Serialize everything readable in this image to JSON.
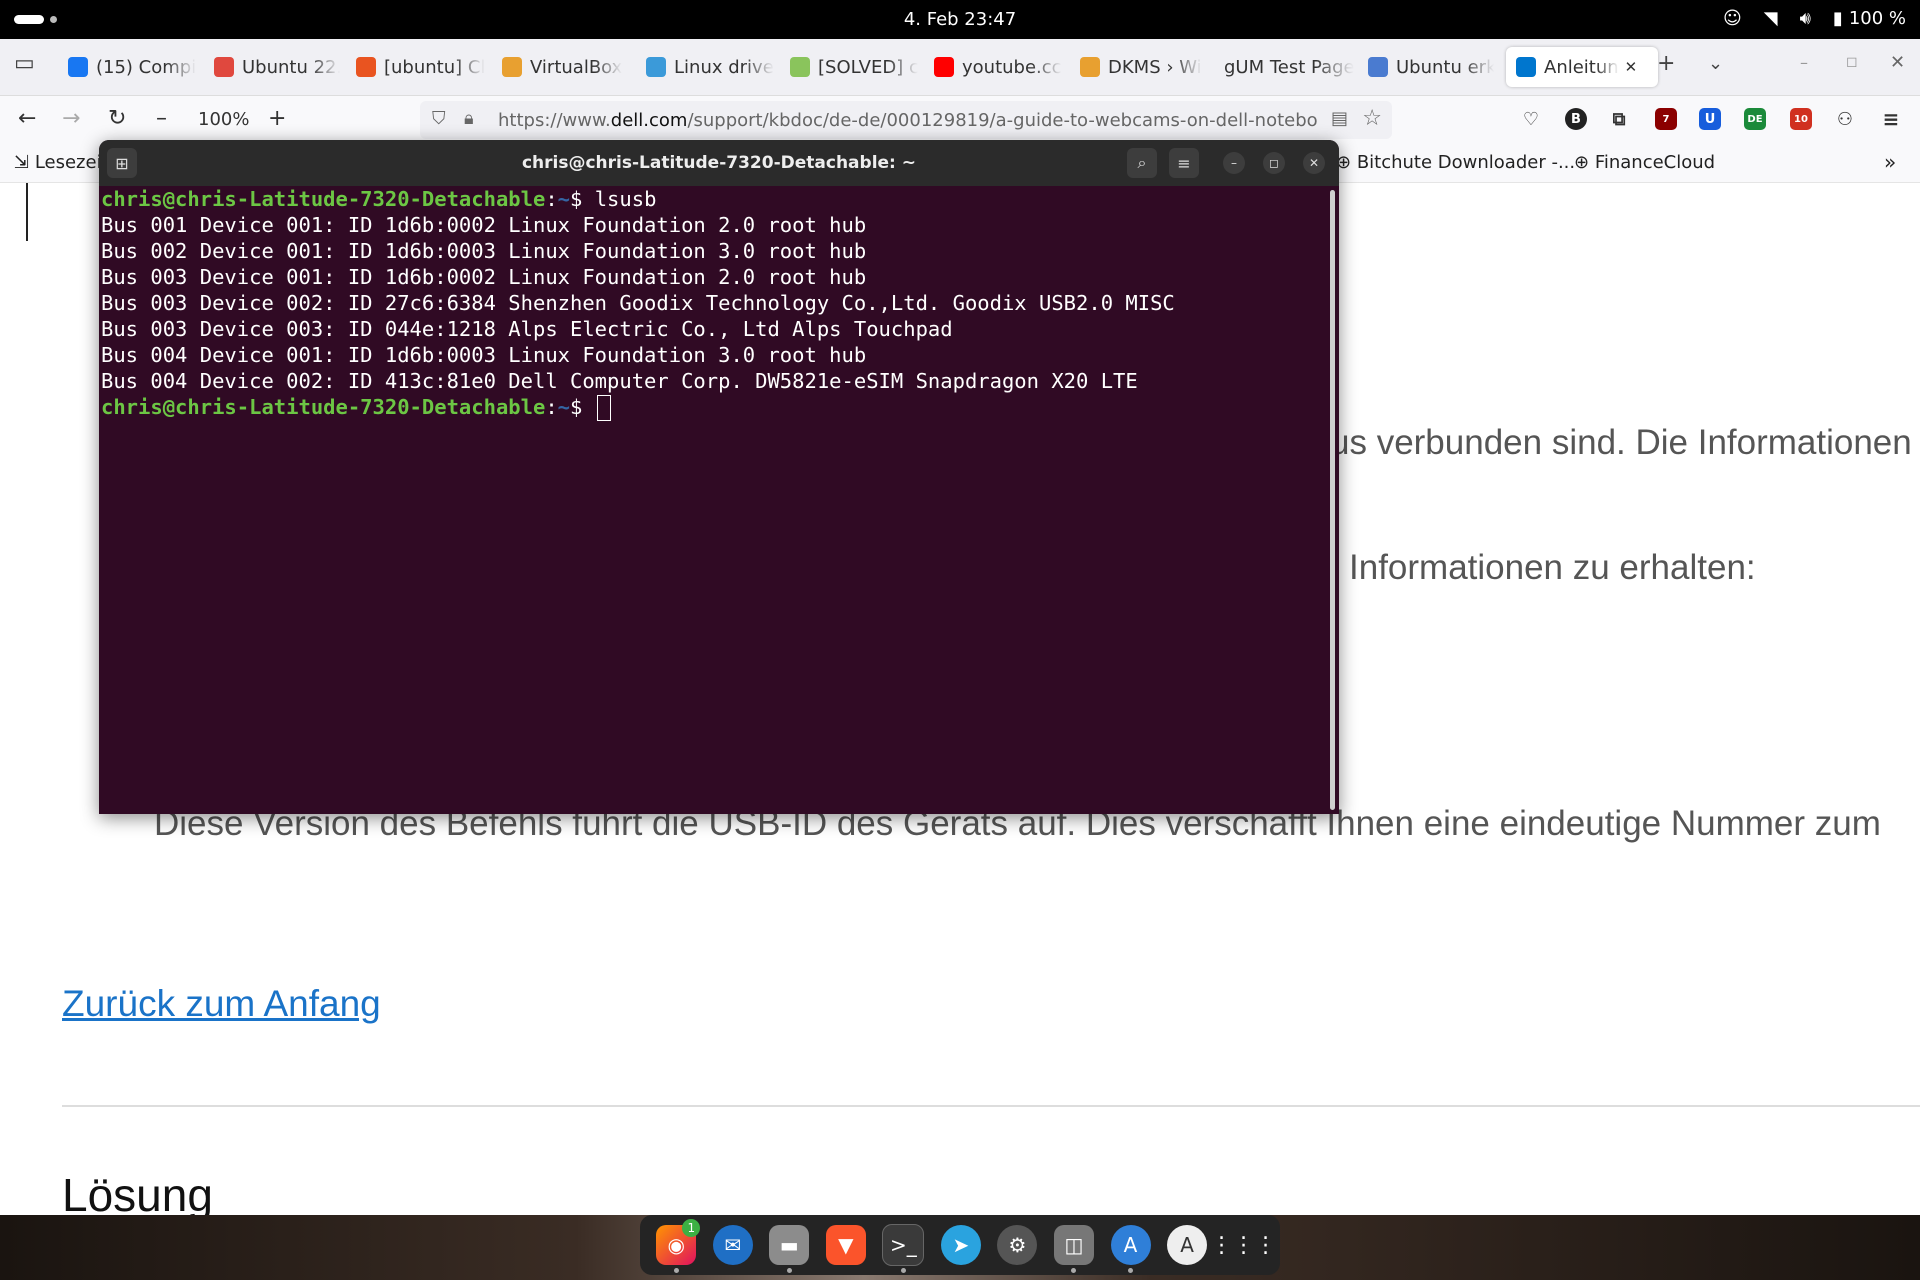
{
  "topbar": {
    "clock": "4. Feb  23:47",
    "battery": "100 %",
    "icons": [
      "accessibility-icon",
      "wifi-icon",
      "volume-icon",
      "battery-icon"
    ]
  },
  "tabs": [
    {
      "title": "(15) Compi",
      "icon": "facebook-icon",
      "color": "#1877f2"
    },
    {
      "title": "Ubuntu 22.",
      "icon": "d-icon",
      "color": "#e0483e"
    },
    {
      "title": "[ubuntu] Cl",
      "icon": "ubuntu-icon",
      "color": "#e95420"
    },
    {
      "title": "VirtualBox",
      "icon": "wiki-icon",
      "color": "#e8a030"
    },
    {
      "title": "Linux drive",
      "icon": "globe-icon",
      "color": "#3b9ad9"
    },
    {
      "title": "[SOLVED] c",
      "icon": "mint-icon",
      "color": "#8ac45c"
    },
    {
      "title": "youtube.cc",
      "icon": "youtube-icon",
      "color": "#ff0000"
    },
    {
      "title": "DKMS › Wi",
      "icon": "wiki-icon",
      "color": "#e8a030"
    },
    {
      "title": "gUM Test Page",
      "icon": "none",
      "color": ""
    },
    {
      "title": "Ubuntu erk",
      "icon": "translate-icon",
      "color": "#4a7bd0"
    },
    {
      "title": "Anleitun",
      "icon": "dell-icon",
      "color": "#0076ce"
    }
  ],
  "nav": {
    "zoom": "100%",
    "url_prefix": "https://www.",
    "url_domain": "dell.com",
    "url_path": "/support/kbdoc/de-de/000129819/a-guide-to-webcams-on-dell-notebook",
    "ext_badges": {
      "ublock": "7",
      "ext10": "10",
      "de": "DE",
      "b": "B"
    }
  },
  "bookmarks": {
    "left": "Lesezei",
    "bitchute": "Bitchute Downloader -...",
    "financecloud": "FinanceCloud"
  },
  "page": {
    "frag1": "us verbunden sind. Die Informationen",
    "frag2": "Informationen zu erhalten:",
    "frag3": "Diese Version des Befehls führt die USB-ID des Geräts auf. Dies verschafft Ihnen eine eindeutige Nummer zum",
    "back_link": "Zurück zum Anfang",
    "heading": "Lösung"
  },
  "terminal": {
    "title": "chris@chris-Latitude-7320-Detachable: ~",
    "prompt_user": "chris@chris-Latitude-7320-Detachable",
    "prompt_path": "~",
    "command": "lsusb",
    "output": [
      "Bus 001 Device 001: ID 1d6b:0002 Linux Foundation 2.0 root hub",
      "Bus 002 Device 001: ID 1d6b:0003 Linux Foundation 3.0 root hub",
      "Bus 003 Device 001: ID 1d6b:0002 Linux Foundation 2.0 root hub",
      "Bus 003 Device 002: ID 27c6:6384 Shenzhen Goodix Technology Co.,Ltd. Goodix USB2.0 MISC",
      "Bus 003 Device 003: ID 044e:1218 Alps Electric Co., Ltd Alps Touchpad",
      "Bus 004 Device 001: ID 1d6b:0003 Linux Foundation 3.0 root hub",
      "Bus 004 Device 002: ID 413c:81e0 Dell Computer Corp. DW5821e-eSIM Snapdragon X20 LTE"
    ]
  },
  "dock": {
    "firefox_badge": "1",
    "apps": [
      "firefox-icon",
      "thunderbird-icon",
      "files-icon",
      "brave-icon",
      "terminal-icon",
      "telegram-icon",
      "settings-icon",
      "screenshot-icon",
      "software-icon",
      "app-center-icon",
      "show-apps-icon"
    ]
  }
}
